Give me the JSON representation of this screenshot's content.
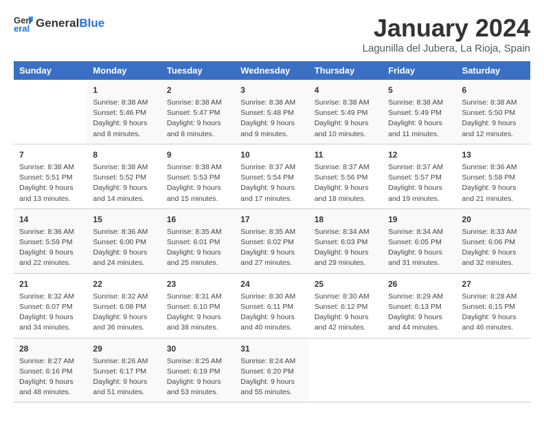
{
  "header": {
    "logo_line1": "General",
    "logo_line2": "Blue",
    "month": "January 2024",
    "location": "Lagunilla del Jubera, La Rioja, Spain"
  },
  "weekdays": [
    "Sunday",
    "Monday",
    "Tuesday",
    "Wednesday",
    "Thursday",
    "Friday",
    "Saturday"
  ],
  "weeks": [
    [
      {
        "day": "",
        "info": ""
      },
      {
        "day": "1",
        "info": "Sunrise: 8:38 AM\nSunset: 5:46 PM\nDaylight: 9 hours\nand 8 minutes."
      },
      {
        "day": "2",
        "info": "Sunrise: 8:38 AM\nSunset: 5:47 PM\nDaylight: 9 hours\nand 8 minutes."
      },
      {
        "day": "3",
        "info": "Sunrise: 8:38 AM\nSunset: 5:48 PM\nDaylight: 9 hours\nand 9 minutes."
      },
      {
        "day": "4",
        "info": "Sunrise: 8:38 AM\nSunset: 5:49 PM\nDaylight: 9 hours\nand 10 minutes."
      },
      {
        "day": "5",
        "info": "Sunrise: 8:38 AM\nSunset: 5:49 PM\nDaylight: 9 hours\nand 11 minutes."
      },
      {
        "day": "6",
        "info": "Sunrise: 8:38 AM\nSunset: 5:50 PM\nDaylight: 9 hours\nand 12 minutes."
      }
    ],
    [
      {
        "day": "7",
        "info": "Sunrise: 8:38 AM\nSunset: 5:51 PM\nDaylight: 9 hours\nand 13 minutes."
      },
      {
        "day": "8",
        "info": "Sunrise: 8:38 AM\nSunset: 5:52 PM\nDaylight: 9 hours\nand 14 minutes."
      },
      {
        "day": "9",
        "info": "Sunrise: 8:38 AM\nSunset: 5:53 PM\nDaylight: 9 hours\nand 15 minutes."
      },
      {
        "day": "10",
        "info": "Sunrise: 8:37 AM\nSunset: 5:54 PM\nDaylight: 9 hours\nand 17 minutes."
      },
      {
        "day": "11",
        "info": "Sunrise: 8:37 AM\nSunset: 5:56 PM\nDaylight: 9 hours\nand 18 minutes."
      },
      {
        "day": "12",
        "info": "Sunrise: 8:37 AM\nSunset: 5:57 PM\nDaylight: 9 hours\nand 19 minutes."
      },
      {
        "day": "13",
        "info": "Sunrise: 8:36 AM\nSunset: 5:58 PM\nDaylight: 9 hours\nand 21 minutes."
      }
    ],
    [
      {
        "day": "14",
        "info": "Sunrise: 8:36 AM\nSunset: 5:59 PM\nDaylight: 9 hours\nand 22 minutes."
      },
      {
        "day": "15",
        "info": "Sunrise: 8:36 AM\nSunset: 6:00 PM\nDaylight: 9 hours\nand 24 minutes."
      },
      {
        "day": "16",
        "info": "Sunrise: 8:35 AM\nSunset: 6:01 PM\nDaylight: 9 hours\nand 25 minutes."
      },
      {
        "day": "17",
        "info": "Sunrise: 8:35 AM\nSunset: 6:02 PM\nDaylight: 9 hours\nand 27 minutes."
      },
      {
        "day": "18",
        "info": "Sunrise: 8:34 AM\nSunset: 6:03 PM\nDaylight: 9 hours\nand 29 minutes."
      },
      {
        "day": "19",
        "info": "Sunrise: 8:34 AM\nSunset: 6:05 PM\nDaylight: 9 hours\nand 31 minutes."
      },
      {
        "day": "20",
        "info": "Sunrise: 8:33 AM\nSunset: 6:06 PM\nDaylight: 9 hours\nand 32 minutes."
      }
    ],
    [
      {
        "day": "21",
        "info": "Sunrise: 8:32 AM\nSunset: 6:07 PM\nDaylight: 9 hours\nand 34 minutes."
      },
      {
        "day": "22",
        "info": "Sunrise: 8:32 AM\nSunset: 6:08 PM\nDaylight: 9 hours\nand 36 minutes."
      },
      {
        "day": "23",
        "info": "Sunrise: 8:31 AM\nSunset: 6:10 PM\nDaylight: 9 hours\nand 38 minutes."
      },
      {
        "day": "24",
        "info": "Sunrise: 8:30 AM\nSunset: 6:11 PM\nDaylight: 9 hours\nand 40 minutes."
      },
      {
        "day": "25",
        "info": "Sunrise: 8:30 AM\nSunset: 6:12 PM\nDaylight: 9 hours\nand 42 minutes."
      },
      {
        "day": "26",
        "info": "Sunrise: 8:29 AM\nSunset: 6:13 PM\nDaylight: 9 hours\nand 44 minutes."
      },
      {
        "day": "27",
        "info": "Sunrise: 8:28 AM\nSunset: 6:15 PM\nDaylight: 9 hours\nand 46 minutes."
      }
    ],
    [
      {
        "day": "28",
        "info": "Sunrise: 8:27 AM\nSunset: 6:16 PM\nDaylight: 9 hours\nand 48 minutes."
      },
      {
        "day": "29",
        "info": "Sunrise: 8:26 AM\nSunset: 6:17 PM\nDaylight: 9 hours\nand 51 minutes."
      },
      {
        "day": "30",
        "info": "Sunrise: 8:25 AM\nSunset: 6:19 PM\nDaylight: 9 hours\nand 53 minutes."
      },
      {
        "day": "31",
        "info": "Sunrise: 8:24 AM\nSunset: 6:20 PM\nDaylight: 9 hours\nand 55 minutes."
      },
      {
        "day": "",
        "info": ""
      },
      {
        "day": "",
        "info": ""
      },
      {
        "day": "",
        "info": ""
      }
    ]
  ]
}
